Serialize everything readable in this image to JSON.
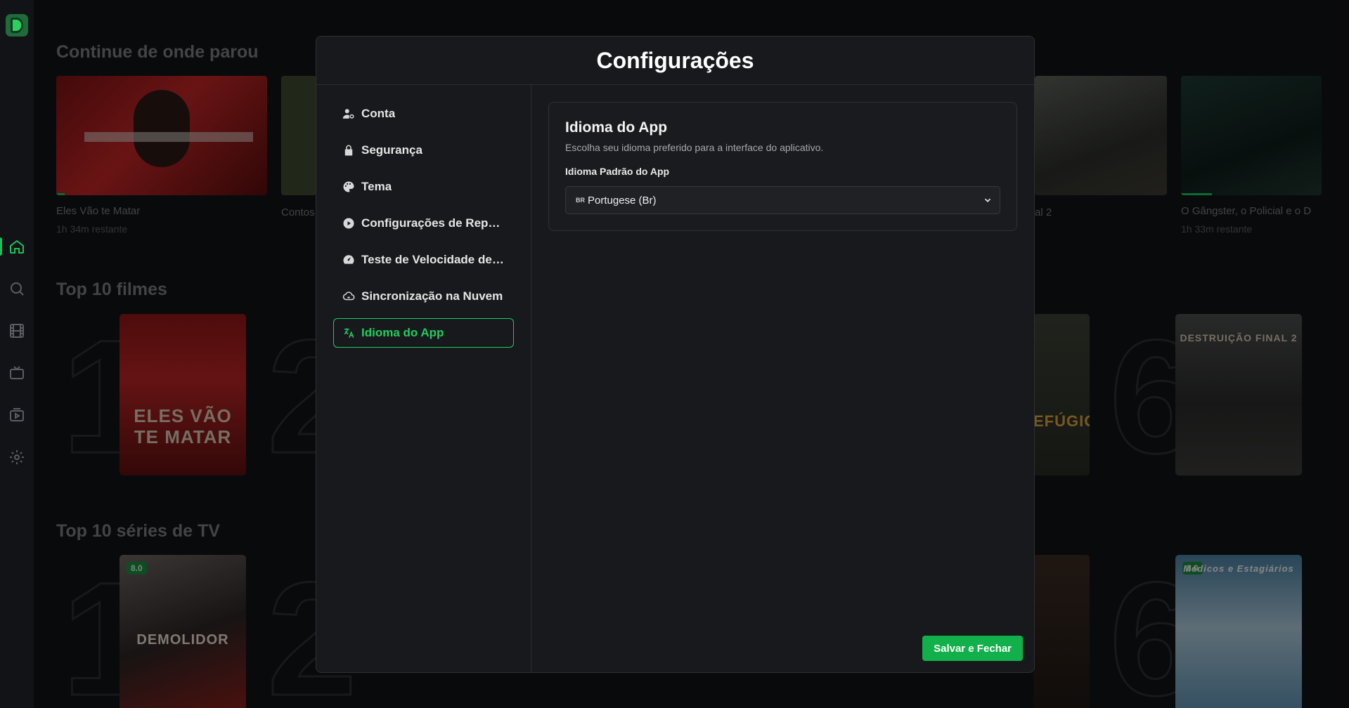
{
  "rail": {
    "logo": "app-logo",
    "icons": [
      "home-icon",
      "search-icon",
      "film-icon",
      "tv-icon",
      "play-icon",
      "gear-icon"
    ]
  },
  "background": {
    "continue_title": "Continue de onde parou",
    "continue_items": [
      {
        "title": "Eles Vão te Matar",
        "sub": "1h 34m restante",
        "progress": 0.04
      },
      {
        "title": "Contos",
        "sub": ""
      },
      {
        "title": "al 2",
        "sub": ""
      },
      {
        "title": "O Gângster, o Policial e o D",
        "sub": "1h 33m restante",
        "progress": 0.22
      }
    ],
    "top_movies_title": "Top 10 filmes",
    "top_movies": [
      {
        "rank": "1",
        "poster_text": "ELES VÃO TE MATAR"
      },
      {
        "rank": "2",
        "poster_text": ""
      },
      {
        "rank": "",
        "poster_text": "EFÚGIO"
      },
      {
        "rank": "6",
        "poster_text": "DESTRUIÇÃO FINAL 2"
      }
    ],
    "top_series_title": "Top 10 séries de TV",
    "top_series": [
      {
        "rank": "1",
        "rating": "8.0",
        "poster_text": "DEMOLIDOR"
      },
      {
        "rank": "2",
        "rating": "",
        "poster_text": ""
      },
      {
        "rank": "6",
        "rating": "8.0",
        "poster_text": "Médicos e Estagiários"
      }
    ]
  },
  "modal": {
    "title": "Configurações",
    "menu": [
      {
        "label": "Conta",
        "icon": "user-cog-icon"
      },
      {
        "label": "Segurança",
        "icon": "lock-icon"
      },
      {
        "label": "Tema",
        "icon": "palette-icon"
      },
      {
        "label": "Configurações de Repro...",
        "icon": "play-circle-icon"
      },
      {
        "label": "Teste de Velocidade de I...",
        "icon": "speedometer-icon"
      },
      {
        "label": "Sincronização na Nuvem",
        "icon": "cloud-sync-icon"
      },
      {
        "label": "Idioma do App",
        "icon": "translate-icon",
        "active": true
      }
    ],
    "panel": {
      "title": "Idioma do App",
      "description": "Escolha seu idioma preferido para a interface do aplicativo.",
      "field_label": "Idioma Padrão do App",
      "select_flag": "BR",
      "select_value": "Portugese (Br)"
    },
    "save_label": "Salvar e Fechar"
  },
  "colors": {
    "accent": "#1fcc5f",
    "button": "#12b04a",
    "background": "#121316"
  }
}
